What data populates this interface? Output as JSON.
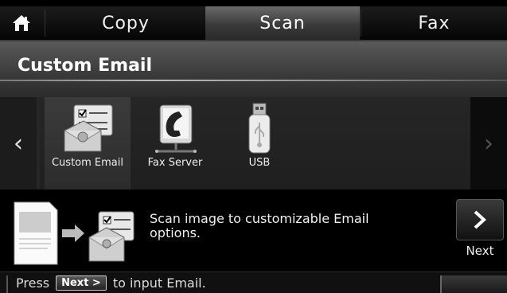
{
  "tabs": {
    "home_icon": "home-icon",
    "items": [
      {
        "label": "Copy"
      },
      {
        "label": "Scan"
      },
      {
        "label": "Fax"
      }
    ],
    "active": "Scan"
  },
  "header": {
    "title": "Custom Email"
  },
  "carousel": {
    "items": [
      {
        "label": "Custom Email",
        "icon": "custom-email-icon",
        "selected": true
      },
      {
        "label": "Fax Server",
        "icon": "fax-server-icon",
        "selected": false
      },
      {
        "label": "USB",
        "icon": "usb-icon",
        "selected": false
      }
    ]
  },
  "description": {
    "text": "Scan image to customizable Email options."
  },
  "next_button": {
    "label": "Next"
  },
  "status": {
    "prefix": "Press",
    "button_label": "Next >",
    "suffix": "to input Email."
  }
}
